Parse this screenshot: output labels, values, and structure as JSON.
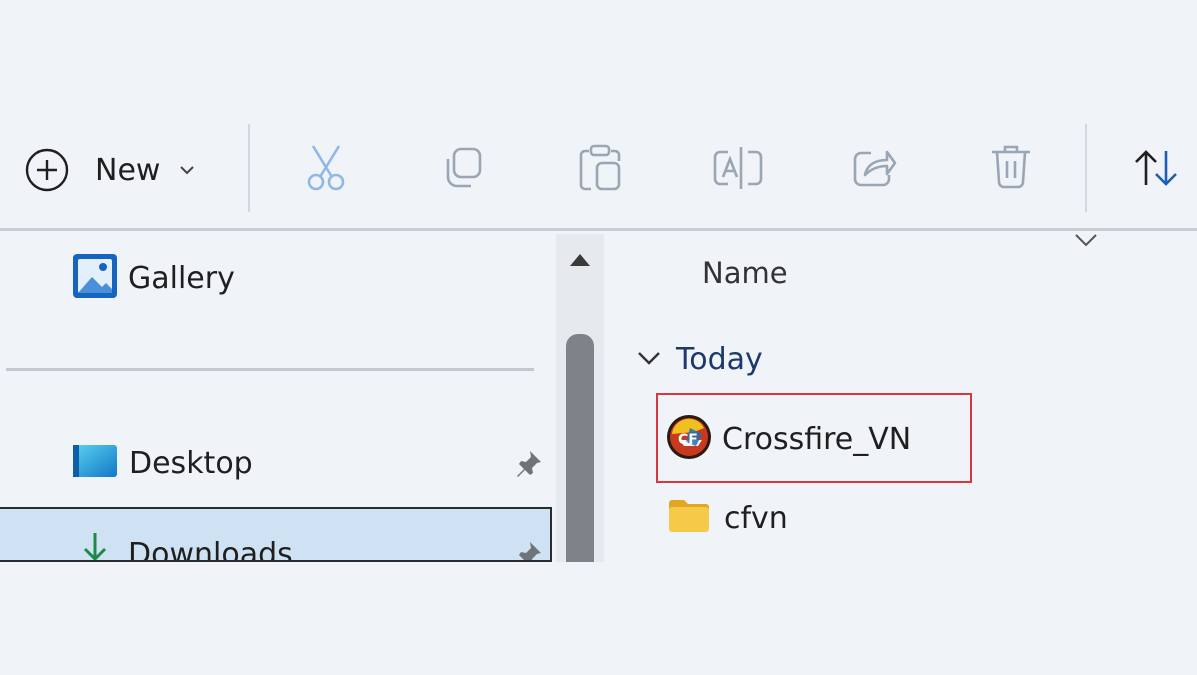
{
  "toolbar": {
    "new_label": "New",
    "icons": [
      "plus-circle-icon",
      "chevron-down-icon",
      "cut-icon",
      "copy-icon",
      "paste-icon",
      "rename-icon",
      "share-icon",
      "delete-icon",
      "sort-icon"
    ]
  },
  "sidebar": {
    "gallery_label": "Gallery",
    "desktop_label": "Desktop",
    "downloads_label": "Downloads"
  },
  "content": {
    "column_name": "Name",
    "group_label": "Today",
    "files": [
      {
        "name": "Crossfire_VN",
        "type": "app"
      },
      {
        "name": "cfvn",
        "type": "folder"
      }
    ],
    "highlight_color": "#d8373d"
  }
}
